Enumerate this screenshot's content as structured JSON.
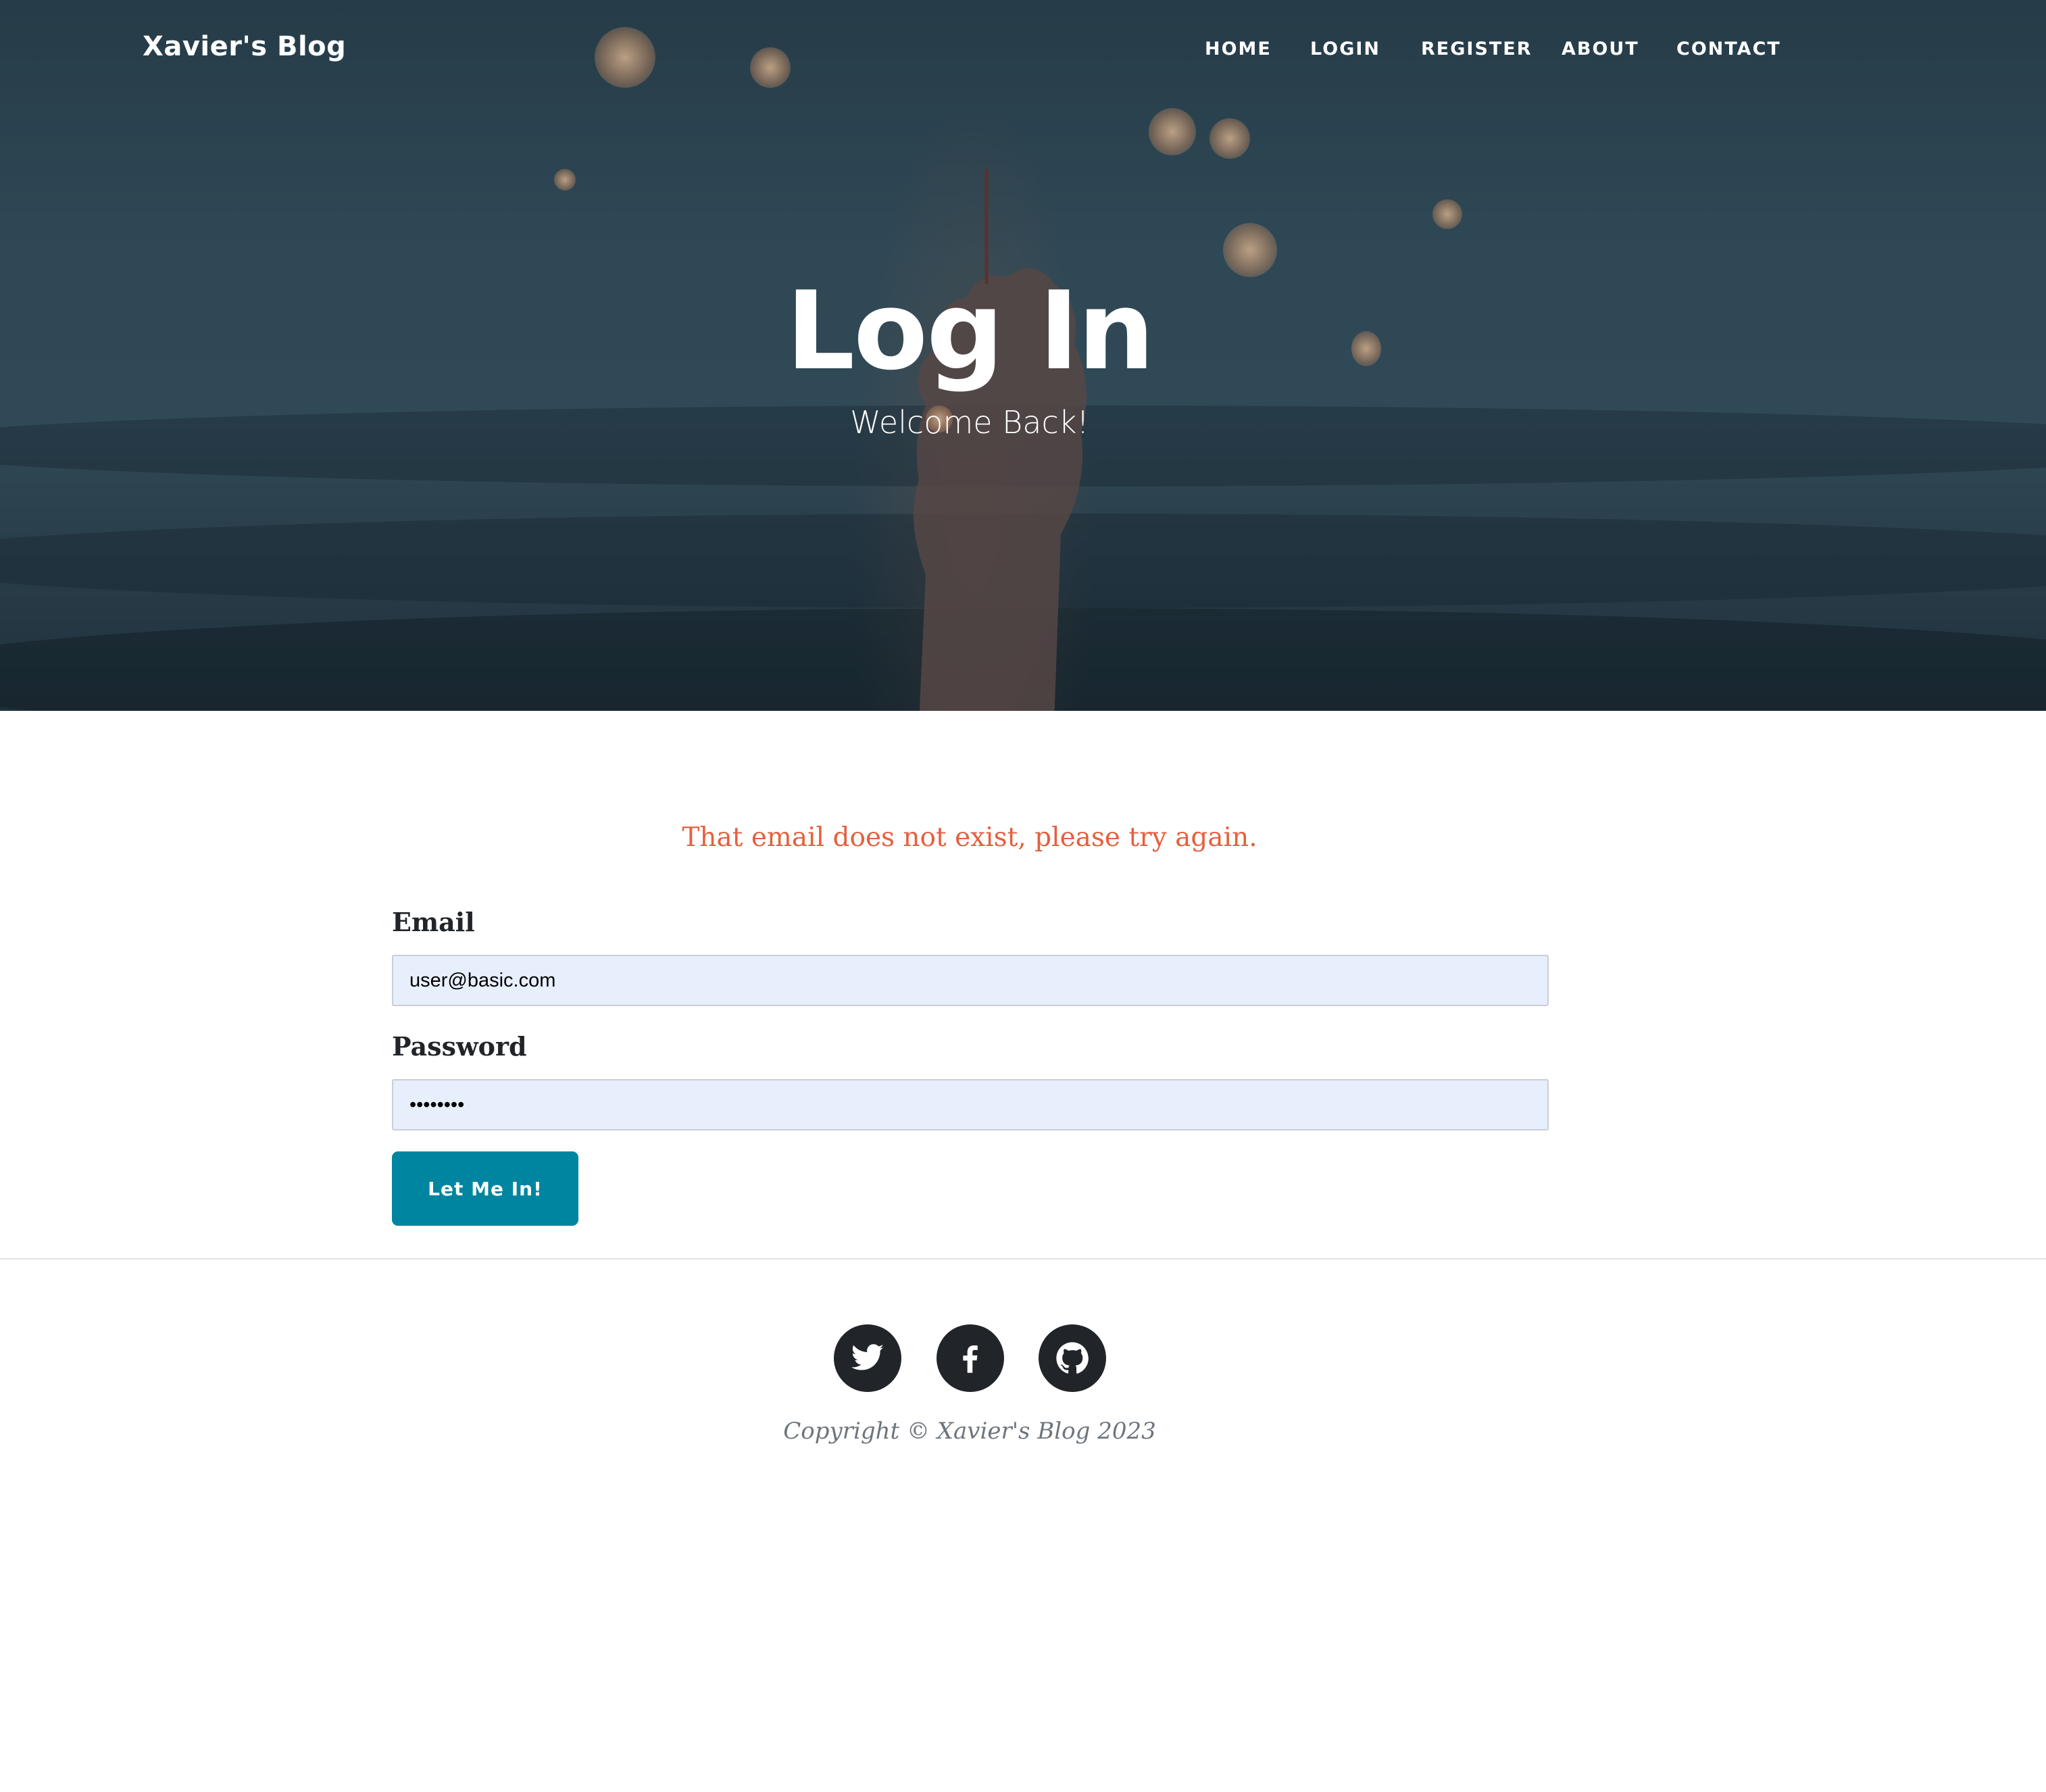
{
  "header": {
    "brand": "Xavier's Blog",
    "nav": [
      "HOME",
      "LOGIN",
      "REGISTER",
      "ABOUT",
      "CONTACT"
    ]
  },
  "hero": {
    "title": "Log In",
    "subtitle": "Welcome Back!"
  },
  "form": {
    "flash_message": "That email does not exist, please try again.",
    "email_label": "Email",
    "email_value": "user@basic.com",
    "password_label": "Password",
    "password_value": "••••••••",
    "submit_label": "Let Me In!"
  },
  "footer": {
    "social_icons": [
      "twitter-icon",
      "facebook-icon",
      "github-icon"
    ],
    "copyright": "Copyright © Xavier's Blog 2023"
  },
  "colors": {
    "primary_button": "#0085a1",
    "error_text": "#e4603f",
    "input_background": "#e8effc",
    "social_circle": "#212529"
  }
}
